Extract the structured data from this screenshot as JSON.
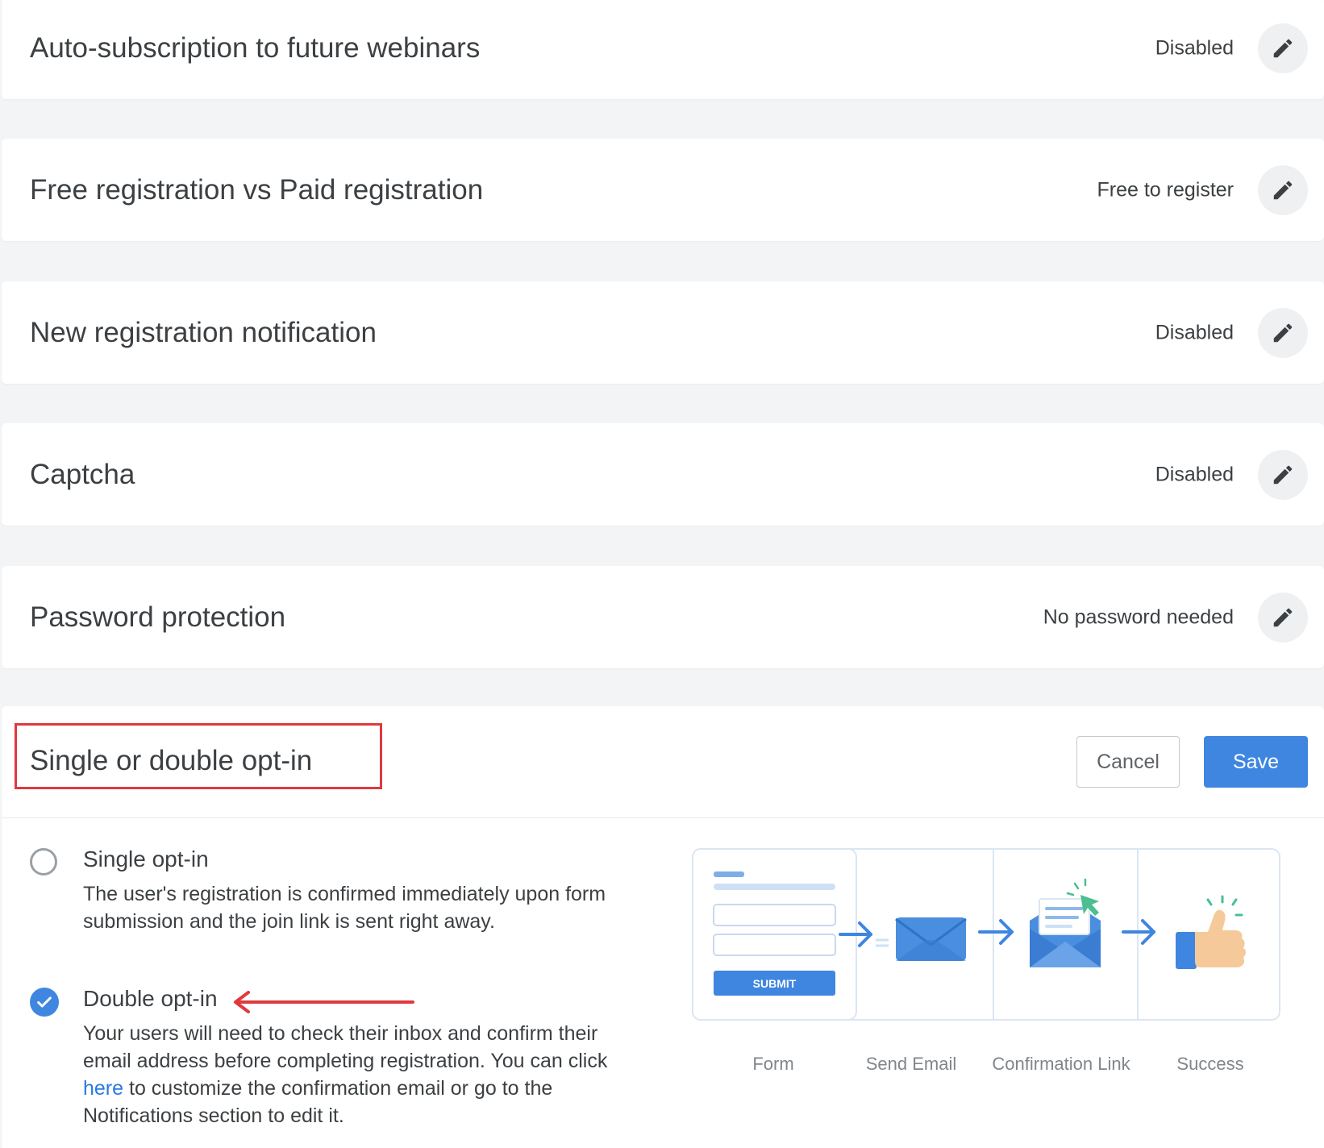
{
  "settings": [
    {
      "title": "Auto-subscription to future webinars",
      "value": "Disabled"
    },
    {
      "title": "Free registration vs Paid registration",
      "value": "Free to register"
    },
    {
      "title": "New registration notification",
      "value": "Disabled"
    },
    {
      "title": "Captcha",
      "value": "Disabled"
    },
    {
      "title": "Password protection",
      "value": "No password needed"
    }
  ],
  "optin": {
    "title": "Single or double opt-in",
    "cancel_label": "Cancel",
    "save_label": "Save",
    "single": {
      "label": "Single opt-in",
      "description": "The user's registration is confirmed immediately upon form submission and the join link is sent right away.",
      "selected": false
    },
    "double": {
      "label": "Double opt-in",
      "description_before": "Your users will need to check their inbox and confirm their email address before completing registration. You can click ",
      "link_text": "here",
      "description_after": " to customize the confirmation email or go to the Notifications section to edit it.",
      "selected": true
    },
    "flow": {
      "submit_label": "SUBMIT",
      "steps": [
        "Form",
        "Send Email",
        "Confirmation Link",
        "Success"
      ]
    }
  },
  "colors": {
    "accent": "#3f86e0",
    "highlight_red": "#e0393e"
  },
  "icons": {
    "edit": "pencil-icon",
    "check": "check-icon",
    "arrow": "red-arrow-annotation"
  }
}
